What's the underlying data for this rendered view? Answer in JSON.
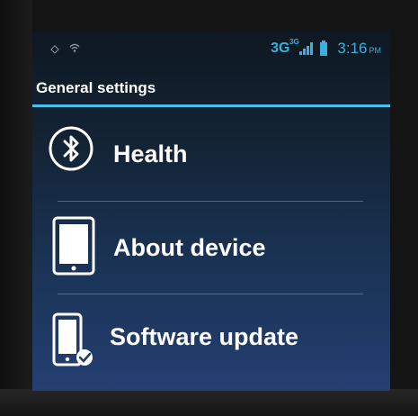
{
  "status_bar": {
    "left_icons": [
      "alarm-icon",
      "wifi-icon"
    ],
    "network_type": "3G",
    "network_badge": "3G",
    "signal_icon": "signal-bars-icon",
    "battery_icon": "battery-icon",
    "time": "3:16",
    "ampm": "PM",
    "accent_color": "#39b0e0"
  },
  "header": {
    "title": "General settings",
    "rule_color": "#4cbde8"
  },
  "menu": {
    "items": [
      {
        "label": "Health",
        "icon": "bluetooth-icon"
      },
      {
        "label": "About device",
        "icon": "tablet-icon"
      },
      {
        "label": "Software update",
        "icon": "phone-update-icon"
      }
    ]
  }
}
